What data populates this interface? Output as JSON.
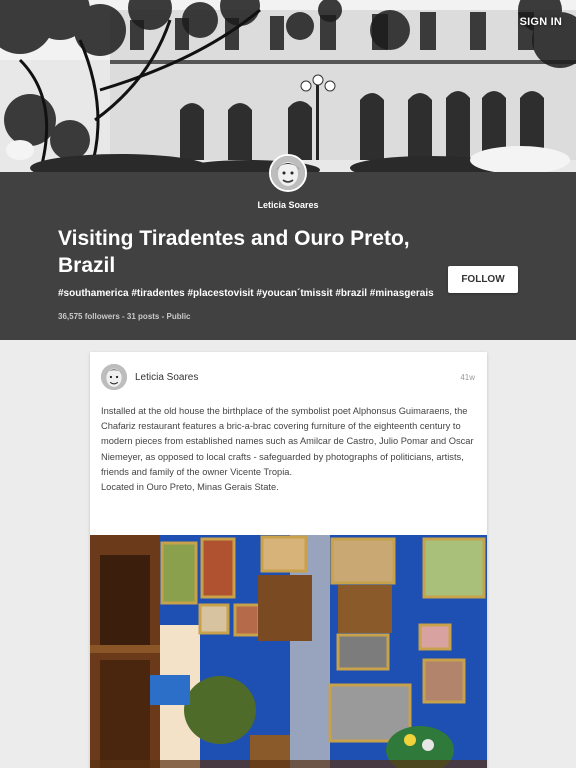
{
  "nav": {
    "sign_in": "SIGN IN"
  },
  "collection": {
    "owner": "Leticia Soares",
    "title": "Visiting Tiradentes and Ouro Preto, Brazil",
    "tags": "#southamerica #tiradentes #placestovisit #youcan´tmissit #brazil #minasgerais",
    "stats": "36,575 followers - 31 posts - Public",
    "follow_label": "FOLLOW"
  },
  "post": {
    "author": "Leticia Soares",
    "time": "41w",
    "body": "Installed at the old house the birthplace of the symbolist poet Alphonsus Guimaraens, the Chafariz restaurant features a bric-a-brac covering furniture of the eighteenth century to modern pieces from established names such as Amilcar de Castro, Julio Pomar and Oscar Niemeyer, as opposed to local crafts - safeguarded by photographs of politicians, artists, friends and family of the owner Vicente Tropia.",
    "location": "Located in Ouro Preto, Minas Gerais State."
  },
  "colors": {
    "header_bg": "#414141",
    "page_bg": "#ececec",
    "wall_blue": "#1e4fb3"
  },
  "icons": {
    "cover": "building-photo",
    "avatar": "profile-photo",
    "post_image": "restaurant-interior-photo"
  }
}
